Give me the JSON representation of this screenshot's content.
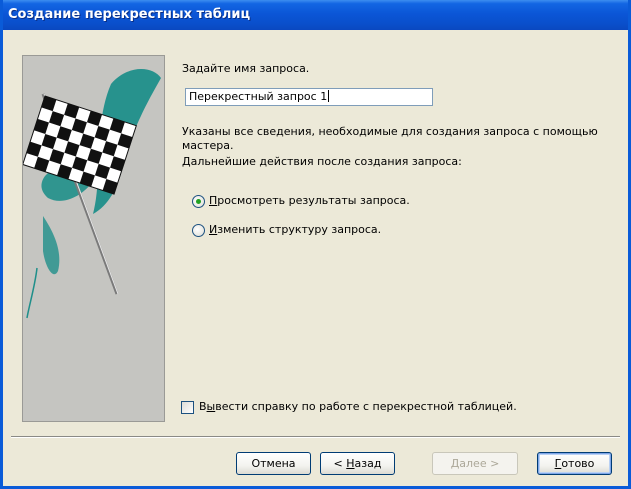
{
  "window": {
    "title": "Создание перекрестных таблиц"
  },
  "form": {
    "name_prompt": "Задайте имя запроса.",
    "query_name": "Перекрестный запрос 1",
    "info_line1": "Указаны все сведения, необходимые для создания запроса с помощью",
    "info_line2": "мастера.",
    "next_actions": "Дальнейшие действия после создания запроса:",
    "options": [
      {
        "mnemonic": "П",
        "rest": "росмотреть результаты запроса.",
        "selected": true
      },
      {
        "mnemonic": "И",
        "rest": "зменить структуру запроса.",
        "selected": false
      }
    ],
    "help_checkbox": {
      "before": "В",
      "mnemonic": "ы",
      "after": "вести справку по работе с перекрестной таблицей.",
      "checked": false
    }
  },
  "buttons": {
    "cancel": "Отмена",
    "back_prefix": "< ",
    "back_mnemonic": "Н",
    "back_rest": "азад",
    "next_mnemonic": "Д",
    "next_rest": "алее >",
    "finish_mnemonic": "Г",
    "finish_rest": "отово"
  },
  "icons": {
    "wizard_art": "checkered-flag-icon"
  },
  "colors": {
    "title_bar": "#0a4fcb",
    "radio_dot": "#21a121",
    "art_bg": "#c5c5c1",
    "teal_stroke": "#1f8f8a"
  }
}
